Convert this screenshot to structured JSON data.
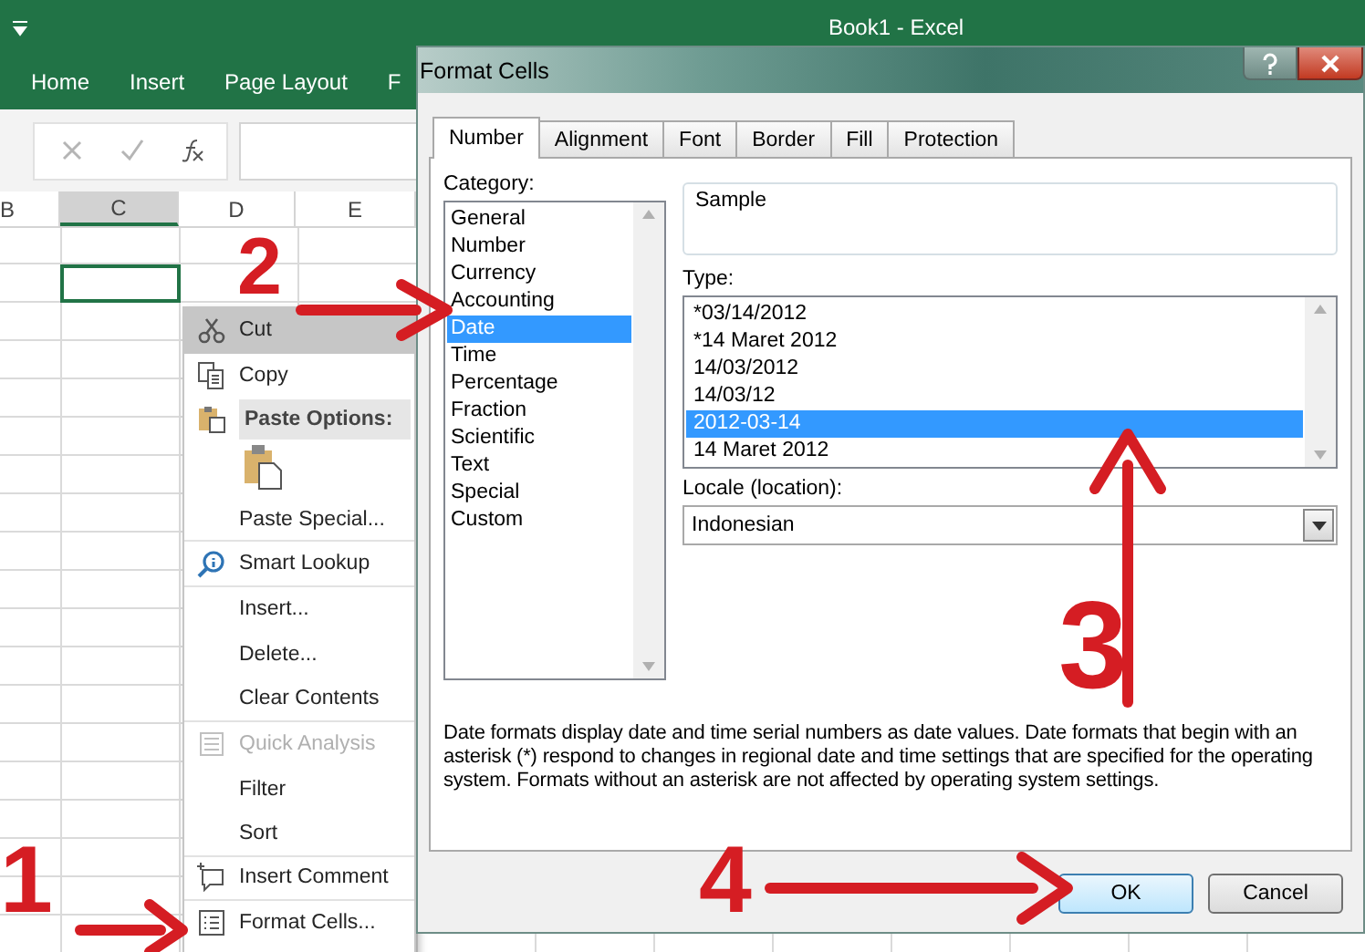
{
  "window": {
    "title": "Book1  -  Excel"
  },
  "ribbon_tabs": [
    {
      "label": "Home"
    },
    {
      "label": "Insert"
    },
    {
      "label": "Page Layout"
    },
    {
      "label": "F"
    }
  ],
  "columns": [
    {
      "label": "B",
      "selected": false
    },
    {
      "label": "C",
      "selected": true
    },
    {
      "label": "D",
      "selected": false
    },
    {
      "label": "E",
      "selected": false
    }
  ],
  "context_menu": {
    "items": [
      {
        "kind": "command",
        "label": "Cut",
        "highlighted": true,
        "disabled": false,
        "divider_below": false
      },
      {
        "kind": "command",
        "label": "Copy",
        "highlighted": false,
        "disabled": false,
        "divider_below": false
      },
      {
        "kind": "header",
        "label": "Paste Options:"
      },
      {
        "kind": "paste-options"
      },
      {
        "kind": "command",
        "label": "Paste Special...",
        "highlighted": false,
        "disabled": false,
        "divider_below": true
      },
      {
        "kind": "command",
        "label": "Smart Lookup",
        "highlighted": false,
        "disabled": false,
        "divider_below": true
      },
      {
        "kind": "command",
        "label": "Insert...",
        "highlighted": false,
        "disabled": false,
        "divider_below": false
      },
      {
        "kind": "command",
        "label": "Delete...",
        "highlighted": false,
        "disabled": false,
        "divider_below": false
      },
      {
        "kind": "command",
        "label": "Clear Contents",
        "highlighted": false,
        "disabled": false,
        "divider_below": true
      },
      {
        "kind": "command",
        "label": "Quick Analysis",
        "highlighted": false,
        "disabled": true,
        "divider_below": false
      },
      {
        "kind": "command",
        "label": "Filter",
        "highlighted": false,
        "disabled": false,
        "divider_below": false
      },
      {
        "kind": "command",
        "label": "Sort",
        "highlighted": false,
        "disabled": false,
        "divider_below": true
      },
      {
        "kind": "command",
        "label": "Insert Comment",
        "highlighted": false,
        "disabled": false,
        "divider_below": true
      },
      {
        "kind": "command",
        "label": "Format Cells...",
        "highlighted": false,
        "disabled": false,
        "divider_below": false
      }
    ]
  },
  "dialog": {
    "title": "Format Cells",
    "tabs": [
      {
        "label": "Number",
        "selected": true
      },
      {
        "label": "Alignment",
        "selected": false
      },
      {
        "label": "Font",
        "selected": false
      },
      {
        "label": "Border",
        "selected": false
      },
      {
        "label": "Fill",
        "selected": false
      },
      {
        "label": "Protection",
        "selected": false
      }
    ],
    "category": {
      "label": "Category:",
      "items": [
        {
          "label": "General",
          "selected": false
        },
        {
          "label": "Number",
          "selected": false
        },
        {
          "label": "Currency",
          "selected": false
        },
        {
          "label": "Accounting",
          "selected": false
        },
        {
          "label": "Date",
          "selected": true
        },
        {
          "label": "Time",
          "selected": false
        },
        {
          "label": "Percentage",
          "selected": false
        },
        {
          "label": "Fraction",
          "selected": false
        },
        {
          "label": "Scientific",
          "selected": false
        },
        {
          "label": "Text",
          "selected": false
        },
        {
          "label": "Special",
          "selected": false
        },
        {
          "label": "Custom",
          "selected": false
        }
      ]
    },
    "sample": {
      "label": "Sample"
    },
    "type": {
      "label": "Type:",
      "items": [
        {
          "label": "*03/14/2012",
          "selected": false
        },
        {
          "label": "*14 Maret 2012",
          "selected": false
        },
        {
          "label": "14/03/2012",
          "selected": false
        },
        {
          "label": "14/03/12",
          "selected": false
        },
        {
          "label": "2012-03-14",
          "selected": true
        },
        {
          "label": "14 Maret 2012",
          "selected": false
        }
      ]
    },
    "locale": {
      "label": "Locale (location):",
      "value": "Indonesian"
    },
    "description": "Date formats display date and time serial numbers as date values.  Date formats that begin with an asterisk (*) respond to changes in regional date and time settings that are specified for the operating system. Formats without an asterisk are not affected by operating system settings.",
    "buttons": [
      {
        "label": "OK",
        "default": true
      },
      {
        "label": "Cancel",
        "default": false
      }
    ]
  },
  "annotations": [
    {
      "label": "1"
    },
    {
      "label": "2"
    },
    {
      "label": "3"
    },
    {
      "label": "4"
    }
  ]
}
